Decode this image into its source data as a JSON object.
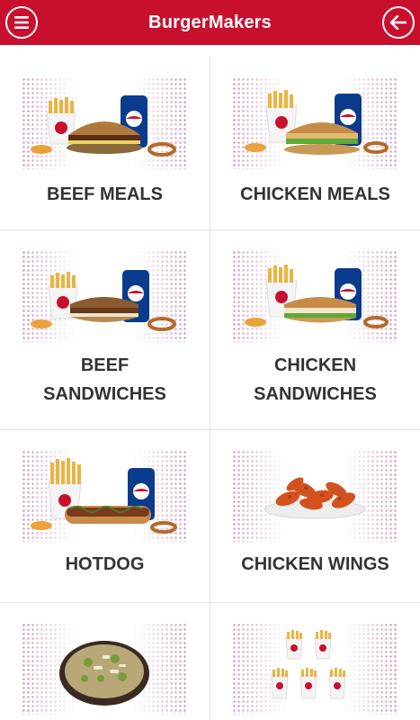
{
  "app": {
    "title": "BurgerMakers"
  },
  "colors": {
    "brand_red": "#c8102e",
    "text_dark": "#333333",
    "divider": "#e3e3e3"
  },
  "header": {
    "menu_icon": "hamburger-menu-icon",
    "back_icon": "back-arrow-icon"
  },
  "categories": [
    {
      "label": "BEEF MEALS",
      "image": "beef-meal-combo"
    },
    {
      "label": "CHICKEN MEALS",
      "image": "chicken-meal-combo"
    },
    {
      "label_line1": "BEEF",
      "label_line2": "SANDWICHES",
      "image": "beef-sandwich-combo"
    },
    {
      "label_line1": "CHICKEN",
      "label_line2": "SANDWICHES",
      "image": "chicken-sandwich-combo"
    },
    {
      "label": "HOTDOG",
      "image": "hotdog-combo"
    },
    {
      "label": "CHICKEN WINGS",
      "image": "chicken-wings-plate"
    },
    {
      "label": "",
      "image": "salad-bowl"
    },
    {
      "label": "",
      "image": "fries-cups"
    }
  ]
}
